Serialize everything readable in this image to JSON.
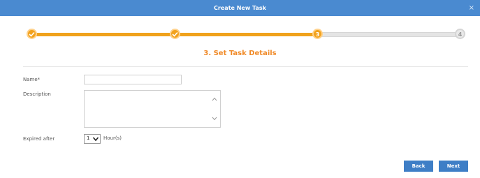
{
  "dialog": {
    "title": "Create New Task",
    "close_label": "×"
  },
  "stepper": {
    "steps": [
      {
        "status": "done",
        "label": ""
      },
      {
        "status": "done",
        "label": ""
      },
      {
        "status": "current",
        "label": "3"
      },
      {
        "status": "todo",
        "label": "4"
      }
    ],
    "accent_color": "#f2a21d"
  },
  "section": {
    "title": "3. Set Task Details"
  },
  "form": {
    "name_label": "Name*",
    "name_value": "",
    "description_label": "Description",
    "description_value": "",
    "expired_label": "Expired after",
    "expired_value": "1",
    "expired_unit": "Hour(s)"
  },
  "buttons": {
    "back_label": "Back",
    "next_label": "Next"
  },
  "colors": {
    "titlebar": "#4a8ad0",
    "button": "#3e7ec6",
    "section_title": "#f08a28"
  }
}
